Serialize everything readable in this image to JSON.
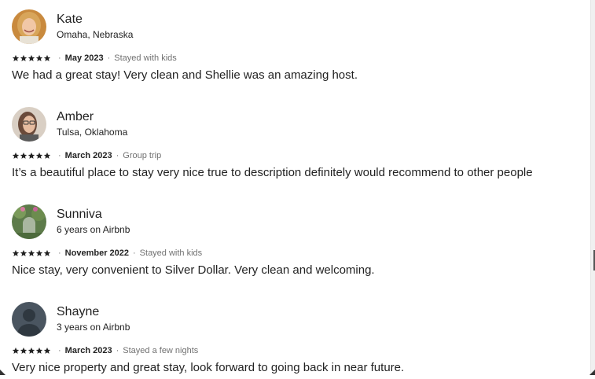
{
  "reviews": [
    {
      "name": "Kate",
      "subtitle": "Omaha, Nebraska",
      "rating": 5,
      "date": "May 2023",
      "trip_type": "Stayed with kids",
      "text": "We had a great stay! Very clean and Shellie was an amazing host.",
      "avatar": "photo-woman-blonde"
    },
    {
      "name": "Amber",
      "subtitle": "Tulsa, Oklahoma",
      "rating": 5,
      "date": "March 2023",
      "trip_type": "Group trip",
      "text": "It’s a beautiful place to stay very nice true to description definitely would recommend to other people",
      "avatar": "photo-woman-glasses"
    },
    {
      "name": "Sunniva",
      "subtitle": "6 years on Airbnb",
      "rating": 5,
      "date": "November 2022",
      "trip_type": "Stayed with kids",
      "text": "Nice stay, very convenient to Silver Dollar. Very clean and welcoming.",
      "avatar": "photo-garden"
    },
    {
      "name": "Shayne",
      "subtitle": "3 years on Airbnb",
      "rating": 5,
      "date": "March 2023",
      "trip_type": "Stayed a few nights",
      "text": "Very nice property and great stay, look forward to going back in near future.",
      "avatar": "default-user-silhouette"
    }
  ],
  "separator": "·",
  "colors": {
    "text": "#222222",
    "muted": "#717171",
    "star": "#222222"
  }
}
